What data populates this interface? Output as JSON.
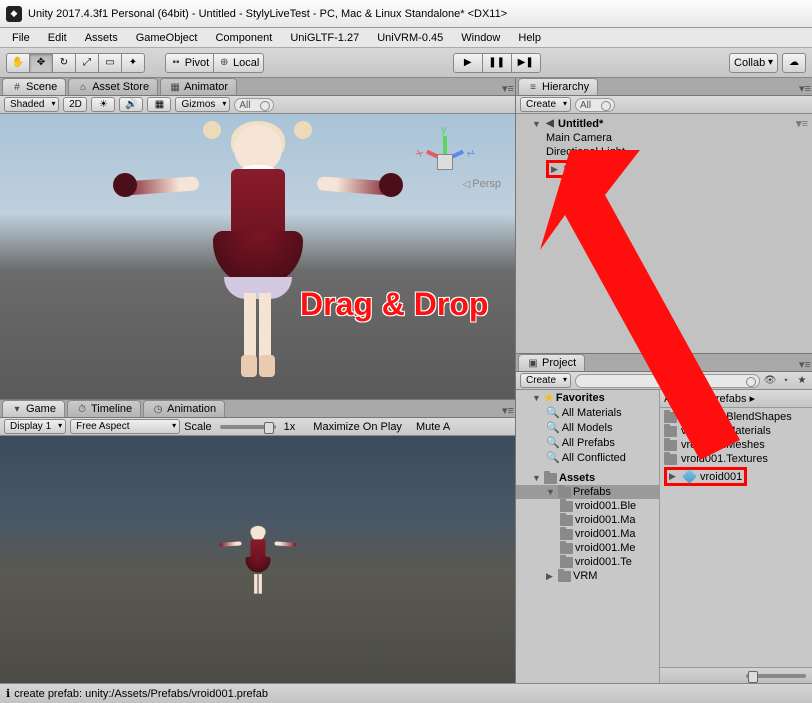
{
  "title": "Unity 2017.4.3f1 Personal (64bit) - Untitled - StylyLiveTest - PC, Mac & Linux Standalone* <DX11>",
  "menu": [
    "File",
    "Edit",
    "Assets",
    "GameObject",
    "Component",
    "UniGLTF-1.27",
    "UniVRM-0.45",
    "Window",
    "Help"
  ],
  "toolbar": {
    "pivot": "Pivot",
    "local": "Local",
    "collab": "Collab"
  },
  "scene": {
    "tabs": [
      "Scene",
      "Asset Store",
      "Animator"
    ],
    "shading": "Shaded",
    "mode2d": "2D",
    "gizmos": "Gizmos",
    "searchAll": "All",
    "persp": "Persp"
  },
  "game": {
    "tabs": [
      "Game",
      "Timeline",
      "Animation"
    ],
    "display": "Display 1",
    "aspect": "Free Aspect",
    "scaleLabel": "Scale",
    "scaleValue": "1x",
    "maximize": "Maximize On Play",
    "mute": "Mute A"
  },
  "hierarchy": {
    "tab": "Hierarchy",
    "create": "Create",
    "searchAll": "All",
    "sceneName": "Untitled*",
    "items": [
      "Main Camera",
      "Directional Light",
      "vroid001"
    ]
  },
  "project": {
    "tab": "Project",
    "create": "Create",
    "favorites": "Favorites",
    "favItems": [
      "All Materials",
      "All Models",
      "All Prefabs",
      "All Conflicted"
    ],
    "assets": "Assets",
    "folders": [
      "Prefabs",
      "vroid001.Bl​e",
      "vroid001.Ma",
      "vroid001.Ma",
      "vroid001.Me",
      "vroid001.Te",
      "VRM"
    ],
    "breadcrumb": [
      "Assets",
      "Prefabs"
    ],
    "rightItems": [
      "vroid001.BlendShapes",
      "vroid001.Materials",
      "vroid001.Meshes",
      "vroid001.Textures"
    ],
    "prefab": "vroid001"
  },
  "status": "create prefab: unity:/Assets/Prefabs/vroid001.prefab",
  "annotation": "Drag & Drop"
}
